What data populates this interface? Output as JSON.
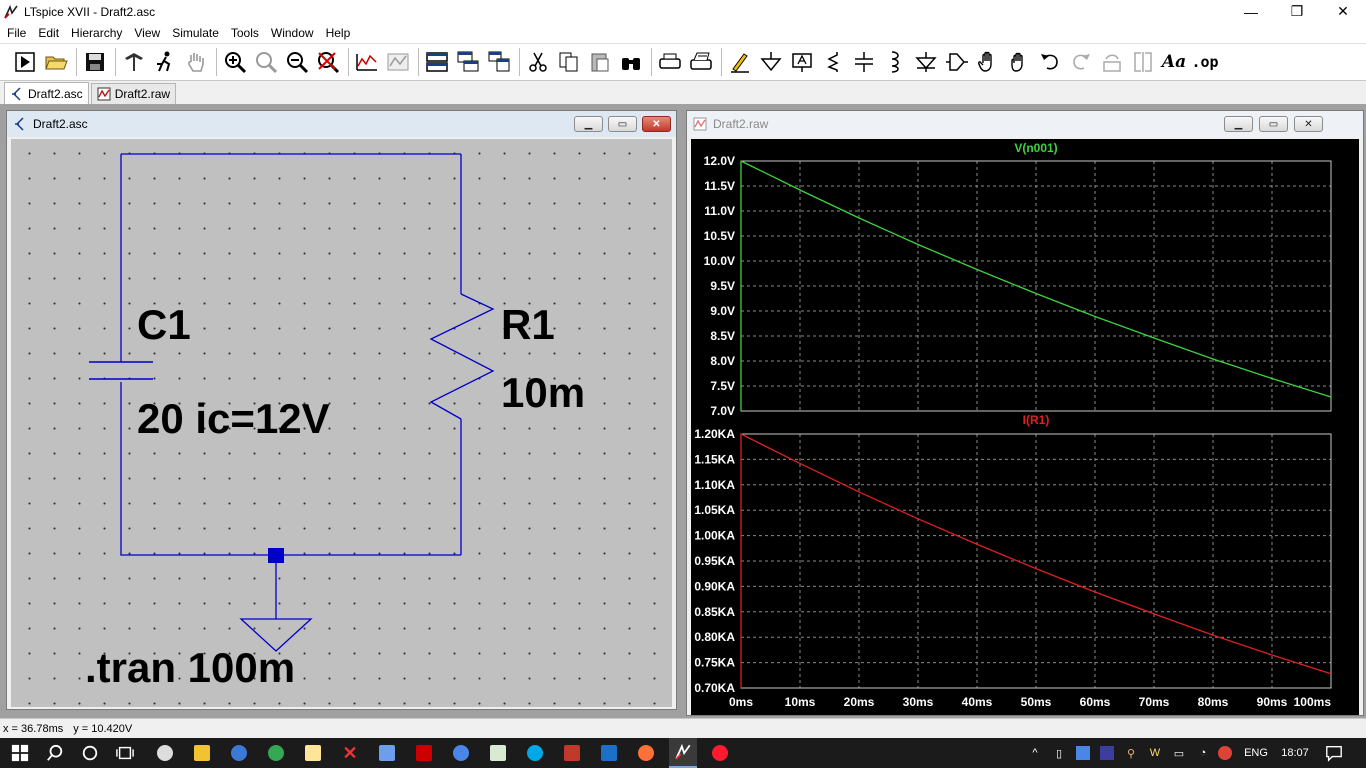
{
  "window": {
    "title": "LTspice XVII - Draft2.asc",
    "minimize_glyph": "—",
    "maximize_glyph": "❐",
    "close_glyph": "✕"
  },
  "menu": [
    "File",
    "Edit",
    "Hierarchy",
    "View",
    "Simulate",
    "Tools",
    "Window",
    "Help"
  ],
  "toolbar_icons": [
    "run-icon",
    "open-icon",
    "save-icon",
    "control-panel-icon",
    "halt-icon",
    "pan-icon",
    "zoom-in-icon",
    "zoom-area-icon",
    "zoom-out-icon",
    "zoom-cancel-icon",
    "autorange-icon",
    "waveform-icon",
    "tile-horizontal-icon",
    "cascade-icon",
    "tile-vertical-icon",
    "cut-icon",
    "copy-icon",
    "paste-icon",
    "find-icon",
    "print-icon",
    "print-setup-icon",
    "draw-wire-icon",
    "ground-icon",
    "label-net-icon",
    "resistor-icon",
    "capacitor-icon",
    "inductor-icon",
    "diode-icon",
    "component-icon",
    "move-icon",
    "drag-icon",
    "undo-icon",
    "redo-icon",
    "rotate-icon",
    "mirror-icon",
    "text-icon",
    "spice-directive-icon"
  ],
  "toolbar_text": {
    "text_tool": "Aa",
    "spice_directive": ".op"
  },
  "tabs": [
    {
      "label": "Draft2.asc",
      "active": true
    },
    {
      "label": "Draft2.raw",
      "active": false
    }
  ],
  "schematic": {
    "title": "Draft2.asc",
    "capacitor": {
      "ref": "C1",
      "value": "20 ic=12V"
    },
    "resistor": {
      "ref": "R1",
      "value": "10m"
    },
    "directive": ".tran 100m",
    "wire_color": "#0000c8"
  },
  "waveform": {
    "title": "Draft2.raw",
    "colors": {
      "voltage": "#3fd23f",
      "current": "#e02020",
      "grid": "#8a8a8a",
      "text": "#ffffff"
    }
  },
  "chart_data": [
    {
      "type": "line",
      "title": "V(n001)",
      "x": [
        0,
        10,
        20,
        30,
        40,
        50,
        60,
        70,
        80,
        90,
        100
      ],
      "x_ticks": [
        "0ms",
        "10ms",
        "20ms",
        "30ms",
        "40ms",
        "50ms",
        "60ms",
        "70ms",
        "80ms",
        "90ms",
        "100ms"
      ],
      "xlim": [
        0,
        100
      ],
      "series": [
        {
          "name": "V(n001)",
          "values": [
            12.0,
            11.42,
            10.86,
            10.33,
            9.83,
            9.35,
            8.89,
            8.46,
            8.04,
            7.65,
            7.28
          ]
        }
      ],
      "ylim": [
        7.0,
        12.0
      ],
      "y_ticks": [
        {
          "v": 12.0,
          "label": "12.0V"
        },
        {
          "v": 11.5,
          "label": "11.5V"
        },
        {
          "v": 11.0,
          "label": "11.0V"
        },
        {
          "v": 10.5,
          "label": "10.5V"
        },
        {
          "v": 10.0,
          "label": "10.0V"
        },
        {
          "v": 9.5,
          "label": "9.5V"
        },
        {
          "v": 9.0,
          "label": "9.0V"
        },
        {
          "v": 8.5,
          "label": "8.5V"
        },
        {
          "v": 8.0,
          "label": "8.0V"
        },
        {
          "v": 7.5,
          "label": "7.5V"
        },
        {
          "v": 7.0,
          "label": "7.0V"
        }
      ],
      "grid": true
    },
    {
      "type": "line",
      "title": "I(R1)",
      "x": [
        0,
        10,
        20,
        30,
        40,
        50,
        60,
        70,
        80,
        90,
        100
      ],
      "x_ticks": [
        "0ms",
        "10ms",
        "20ms",
        "30ms",
        "40ms",
        "50ms",
        "60ms",
        "70ms",
        "80ms",
        "90ms",
        "100ms"
      ],
      "xlim": [
        0,
        100
      ],
      "series": [
        {
          "name": "I(R1)",
          "values": [
            1.2,
            1.142,
            1.086,
            1.033,
            0.983,
            0.935,
            0.889,
            0.846,
            0.804,
            0.765,
            0.728
          ]
        }
      ],
      "ylim": [
        0.7,
        1.2
      ],
      "y_ticks": [
        {
          "v": 1.2,
          "label": "1.20KA"
        },
        {
          "v": 1.15,
          "label": "1.15KA"
        },
        {
          "v": 1.1,
          "label": "1.10KA"
        },
        {
          "v": 1.05,
          "label": "1.05KA"
        },
        {
          "v": 1.0,
          "label": "1.00KA"
        },
        {
          "v": 0.95,
          "label": "0.95KA"
        },
        {
          "v": 0.9,
          "label": "0.90KA"
        },
        {
          "v": 0.85,
          "label": "0.85KA"
        },
        {
          "v": 0.8,
          "label": "0.80KA"
        },
        {
          "v": 0.75,
          "label": "0.75KA"
        },
        {
          "v": 0.7,
          "label": "0.70KA"
        }
      ],
      "grid": true
    }
  ],
  "status": {
    "x": "x = 36.78ms",
    "y": "y = 10.420V"
  },
  "taskbar": {
    "apps": [
      "windows-start-icon",
      "search-icon",
      "cortana-icon",
      "task-view-icon",
      "app-check-icon",
      "file-explorer-icon",
      "browser-icon",
      "chrome-icon",
      "notepad-icon",
      "x-app-icon",
      "calculator-icon",
      "red-app-icon",
      "blue-app-icon",
      "store-icon",
      "skype-icon",
      "red-pen-icon",
      "outlook-icon",
      "firefox-icon",
      "ltspice-icon",
      "opera-icon"
    ],
    "language": "ENG",
    "time": "18:07"
  }
}
